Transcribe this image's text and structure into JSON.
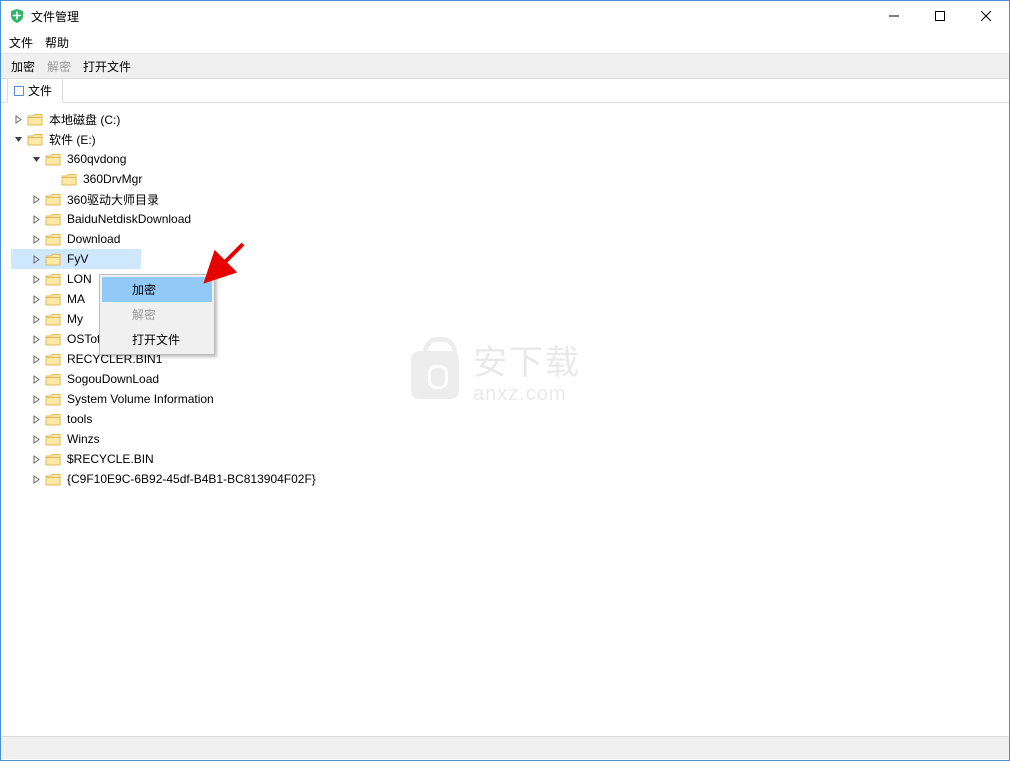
{
  "window": {
    "title": "文件管理"
  },
  "menu": {
    "file": "文件",
    "help": "帮助"
  },
  "toolbar": {
    "encrypt": "加密",
    "decrypt": "解密",
    "open_file": "打开文件"
  },
  "tab": {
    "label": "文件"
  },
  "tree": {
    "c_drive": "本地磁盘 (C:)",
    "e_drive": "软件 (E:)",
    "e_children": {
      "qvdong": "360qvdong",
      "qvdong_child": "360DrvMgr",
      "drv_master": "360驱动大师目录",
      "baidu": "BaiduNetdiskDownload",
      "download": "Download",
      "fy": "FyV",
      "lon": "LON",
      "ma": "MA",
      "my": "My",
      "ostoto": "OSTotoFolder",
      "recycler_bin1": "RECYCLER.BIN1",
      "sogou": "SogouDownLoad",
      "sysvol": "System Volume Information",
      "tools": "tools",
      "winzs": "Winzs",
      "recycle_bin": "$RECYCLE.BIN",
      "guid": "{C9F10E9C-6B92-45df-B4B1-BC813904F02F}"
    }
  },
  "context_menu": {
    "encrypt": "加密",
    "decrypt": "解密",
    "open_file": "打开文件"
  },
  "watermark": {
    "cn": "安下载",
    "en": "anxz.com"
  }
}
